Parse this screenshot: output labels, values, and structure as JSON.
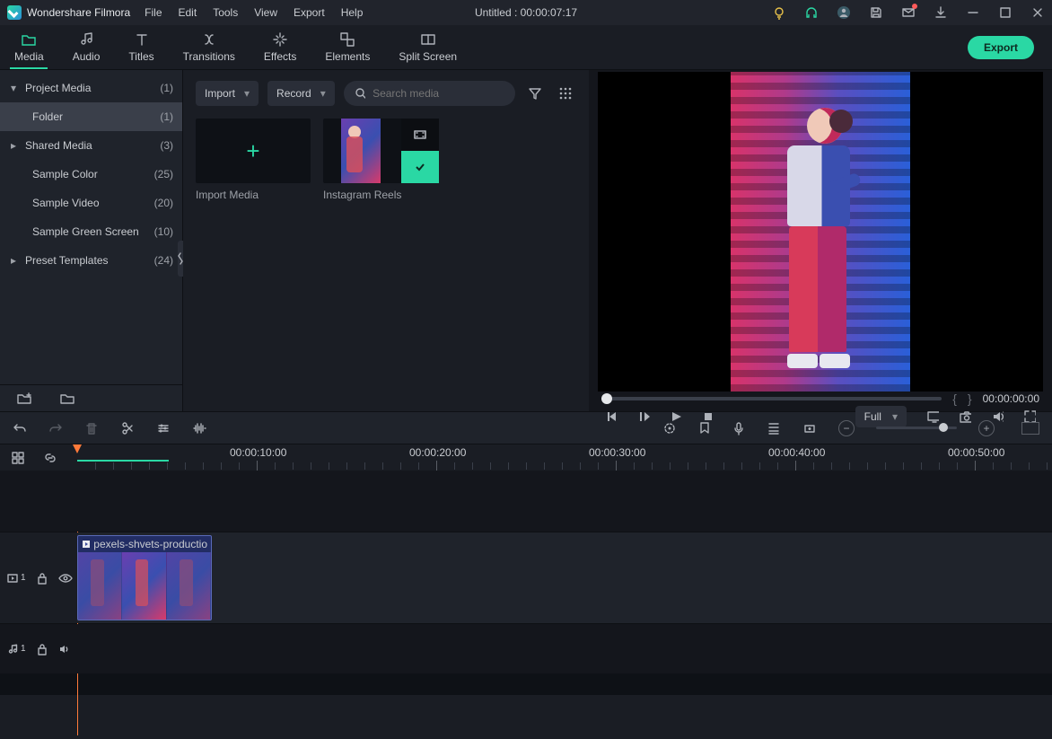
{
  "app_name": "Wondershare Filmora",
  "menu": [
    "File",
    "Edit",
    "Tools",
    "View",
    "Export",
    "Help"
  ],
  "doc_title": "Untitled : 00:00:07:17",
  "tabs": [
    {
      "label": "Media"
    },
    {
      "label": "Audio"
    },
    {
      "label": "Titles"
    },
    {
      "label": "Transitions"
    },
    {
      "label": "Effects"
    },
    {
      "label": "Elements"
    },
    {
      "label": "Split Screen"
    }
  ],
  "export_btn": "Export",
  "sidebar": {
    "items": [
      {
        "label": "Project Media",
        "count": "(1)",
        "expander": "▾",
        "indent": false,
        "sel": false
      },
      {
        "label": "Folder",
        "count": "(1)",
        "expander": "",
        "indent": true,
        "sel": true
      },
      {
        "label": "Shared Media",
        "count": "(3)",
        "expander": "▸",
        "indent": false,
        "sel": false
      },
      {
        "label": "Sample Color",
        "count": "(25)",
        "expander": "",
        "indent": true,
        "sel": false
      },
      {
        "label": "Sample Video",
        "count": "(20)",
        "expander": "",
        "indent": true,
        "sel": false
      },
      {
        "label": "Sample Green Screen",
        "count": "(10)",
        "expander": "",
        "indent": true,
        "sel": false
      },
      {
        "label": "Preset Templates",
        "count": "(24)",
        "expander": "▸",
        "indent": false,
        "sel": false
      }
    ]
  },
  "media": {
    "import_label": "Import",
    "record_label": "Record",
    "search_placeholder": "Search media",
    "thumb_import": "Import Media",
    "thumb_clip": "Instagram Reels"
  },
  "preview": {
    "mark_in": "{",
    "mark_out": "}",
    "timecode": "00:00:00:00",
    "quality": "Full"
  },
  "ruler": {
    "labels": [
      "00:00:10:00",
      "00:00:20:00",
      "00:00:30:00",
      "00:00:40:00",
      "00:00:50:00"
    ]
  },
  "track": {
    "video_id": "1",
    "audio_id": "1",
    "clip_name": "pexels-shvets-productio"
  }
}
